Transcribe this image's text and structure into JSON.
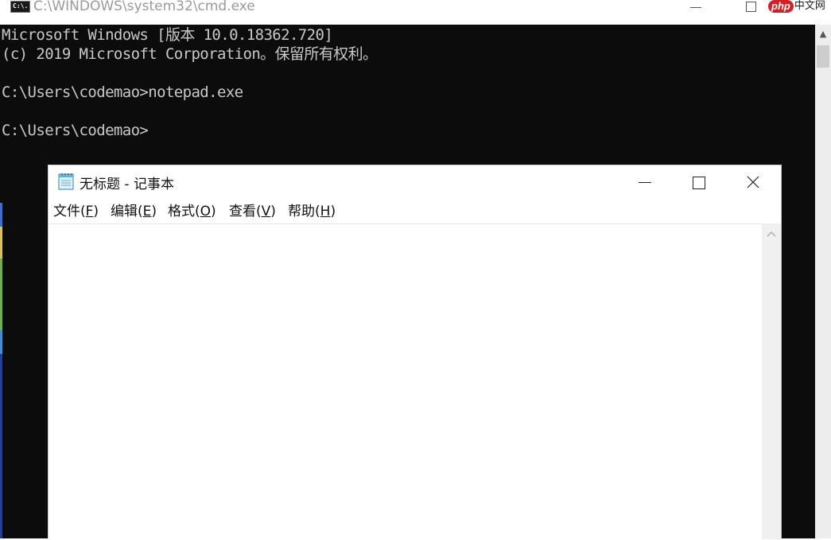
{
  "cmd": {
    "title": "C:\\WINDOWS\\system32\\cmd.exe",
    "icon_label": "C:\\.",
    "watermark_badge": "php",
    "watermark_text": "中文网",
    "lines": [
      "Microsoft Windows [版本 10.0.18362.720]",
      "(c) 2019 Microsoft Corporation。保留所有权利。",
      "",
      "C:\\Users\\codemao>notepad.exe",
      "",
      "C:\\Users\\codemao>"
    ]
  },
  "notepad": {
    "title": "无标题 - 记事本",
    "menu": [
      {
        "label": "文件(",
        "acc": "F",
        "end": ")"
      },
      {
        "label": "编辑(",
        "acc": "E",
        "end": ")"
      },
      {
        "label": "格式(",
        "acc": "O",
        "end": ")"
      },
      {
        "label": "查看(",
        "acc": "V",
        "end": ")"
      },
      {
        "label": "帮助(",
        "acc": "H",
        "end": ")"
      }
    ],
    "content": ""
  },
  "icons": {
    "cmd_icon": "console-icon",
    "notepad_icon": "notepad-icon",
    "minimize": "minimize-icon",
    "maximize": "maximize-icon",
    "close": "close-icon",
    "scroll_up": "chevron-up-icon"
  },
  "colors": {
    "console_bg": "#0c0c0c",
    "console_text": "#c8c8c8",
    "watermark_red": "#d51f24"
  }
}
